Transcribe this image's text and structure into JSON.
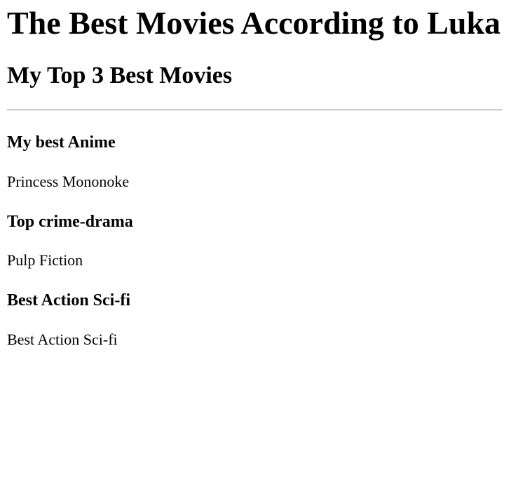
{
  "page": {
    "title": "The Best Movies According to Luka",
    "subtitle": "My Top 3 Best Movies"
  },
  "sections": [
    {
      "heading": "My best Anime",
      "movie": "Princess Mononoke"
    },
    {
      "heading": "Top crime-drama",
      "movie": "Pulp Fiction"
    },
    {
      "heading": "Best Action Sci-fi",
      "movie": "Best Action Sci-fi"
    }
  ]
}
